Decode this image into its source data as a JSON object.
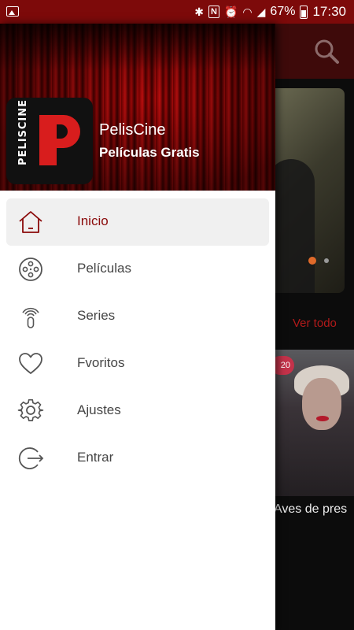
{
  "status_bar": {
    "icons": [
      "image-icon",
      "bluetooth-icon",
      "nfc-icon",
      "alarm-icon",
      "wifi-icon",
      "signal-icon"
    ],
    "battery": "67%",
    "time": "17:30"
  },
  "background": {
    "see_all": "Ver todo",
    "badge": "20",
    "poster_title": "Aves de pres"
  },
  "drawer": {
    "logo_text": "PELISCINE",
    "app_name": "PelisCine",
    "app_subtitle": "Películas Gratis",
    "items": [
      {
        "label": "Inicio",
        "icon": "home-icon",
        "active": true
      },
      {
        "label": "Películas",
        "icon": "film-reel-icon",
        "active": false
      },
      {
        "label": "Series",
        "icon": "broadcast-icon",
        "active": false
      },
      {
        "label": "Fvoritos",
        "icon": "heart-icon",
        "active": false
      },
      {
        "label": "Ajustes",
        "icon": "gear-icon",
        "active": false
      },
      {
        "label": "Entrar",
        "icon": "login-icon",
        "active": false
      }
    ]
  },
  "colors": {
    "accent": "#8a0a0a",
    "status_bar": "#7d0a0a"
  }
}
